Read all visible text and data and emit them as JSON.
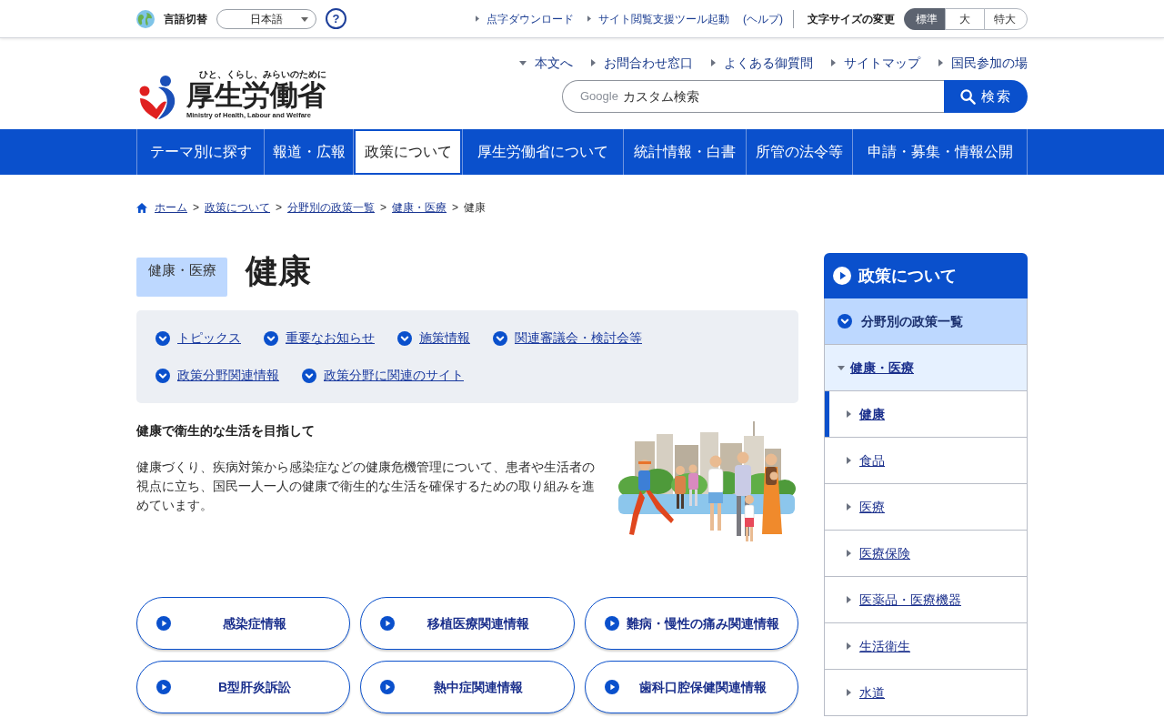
{
  "top_bar": {
    "language_label": "言語切替",
    "language_select": {
      "value": "日本語"
    },
    "help_button": "?",
    "support_links": [
      {
        "label": "点字ダウンロード"
      },
      {
        "label": "サイト閲覧支援ツール起動"
      }
    ],
    "help_link": "(ヘルプ)",
    "font_size": {
      "label": "文字サイズの変更",
      "options": [
        {
          "label": "標準",
          "selected": true
        },
        {
          "label": "大",
          "selected": false
        },
        {
          "label": "特大",
          "selected": false
        }
      ]
    }
  },
  "header": {
    "logo": {
      "tagline": "ひと、くらし、みらいのために",
      "name": "厚生労働省",
      "english": "Ministry of Health, Labour and Welfare"
    },
    "utility_links": [
      {
        "label": "本文へ",
        "kind": "anchor"
      },
      {
        "label": "お問合わせ窓口",
        "kind": "link"
      },
      {
        "label": "よくある御質問",
        "kind": "link"
      },
      {
        "label": "サイトマップ",
        "kind": "link"
      },
      {
        "label": "国民参加の場",
        "kind": "link"
      }
    ],
    "search": {
      "brand": "Google",
      "placeholder": "カスタム検索",
      "button": "検索"
    }
  },
  "global_nav": [
    {
      "label": "テーマ別に探す",
      "selected": false
    },
    {
      "label": "報道・広報",
      "selected": false
    },
    {
      "label": "政策について",
      "selected": true
    },
    {
      "label": "厚生労働省について",
      "selected": false
    },
    {
      "label": "統計情報・白書",
      "selected": false
    },
    {
      "label": "所管の法令等",
      "selected": false
    },
    {
      "label": "申請・募集・情報公開",
      "selected": false
    }
  ],
  "breadcrumb": {
    "links": [
      "ホーム",
      "政策について",
      "分野別の政策一覧",
      "健康・医療"
    ],
    "separator": ">",
    "current": "健康"
  },
  "page": {
    "category": "健康・医療",
    "title": "健康"
  },
  "topics": [
    "トピックス",
    "重要なお知らせ",
    "施策情報",
    "関連審議会・検討会等",
    "政策分野関連情報",
    "政策分野に関連のサイト"
  ],
  "intro": {
    "heading": "健康で衛生的な生活を目指して",
    "body": "健康づくり、疾病対策から感染症などの健康危機管理について、患者や生活者の視点に立ち、国民一人一人の健康で衛生的な生活を確保するための取り組みを進めています。"
  },
  "link_buttons": [
    "感染症情報",
    "移植医療関連情報",
    "難病・慢性の痛み関連情報",
    "B型肝炎訴訟",
    "熱中症関連情報",
    "歯科口腔保健関連情報"
  ],
  "sidebar": {
    "title": "政策について",
    "items": [
      {
        "label": "分野別の政策一覧",
        "expanded": true,
        "children": [
          {
            "label": "健康・医療",
            "expanded": true,
            "children": [
              {
                "label": "健康",
                "selected": true
              },
              {
                "label": "食品",
                "selected": false
              },
              {
                "label": "医療",
                "selected": false
              },
              {
                "label": "医療保険",
                "selected": false
              },
              {
                "label": "医薬品・医療機器",
                "selected": false
              },
              {
                "label": "生活衛生",
                "selected": false
              },
              {
                "label": "水道",
                "selected": false
              }
            ]
          }
        ]
      }
    ]
  }
}
